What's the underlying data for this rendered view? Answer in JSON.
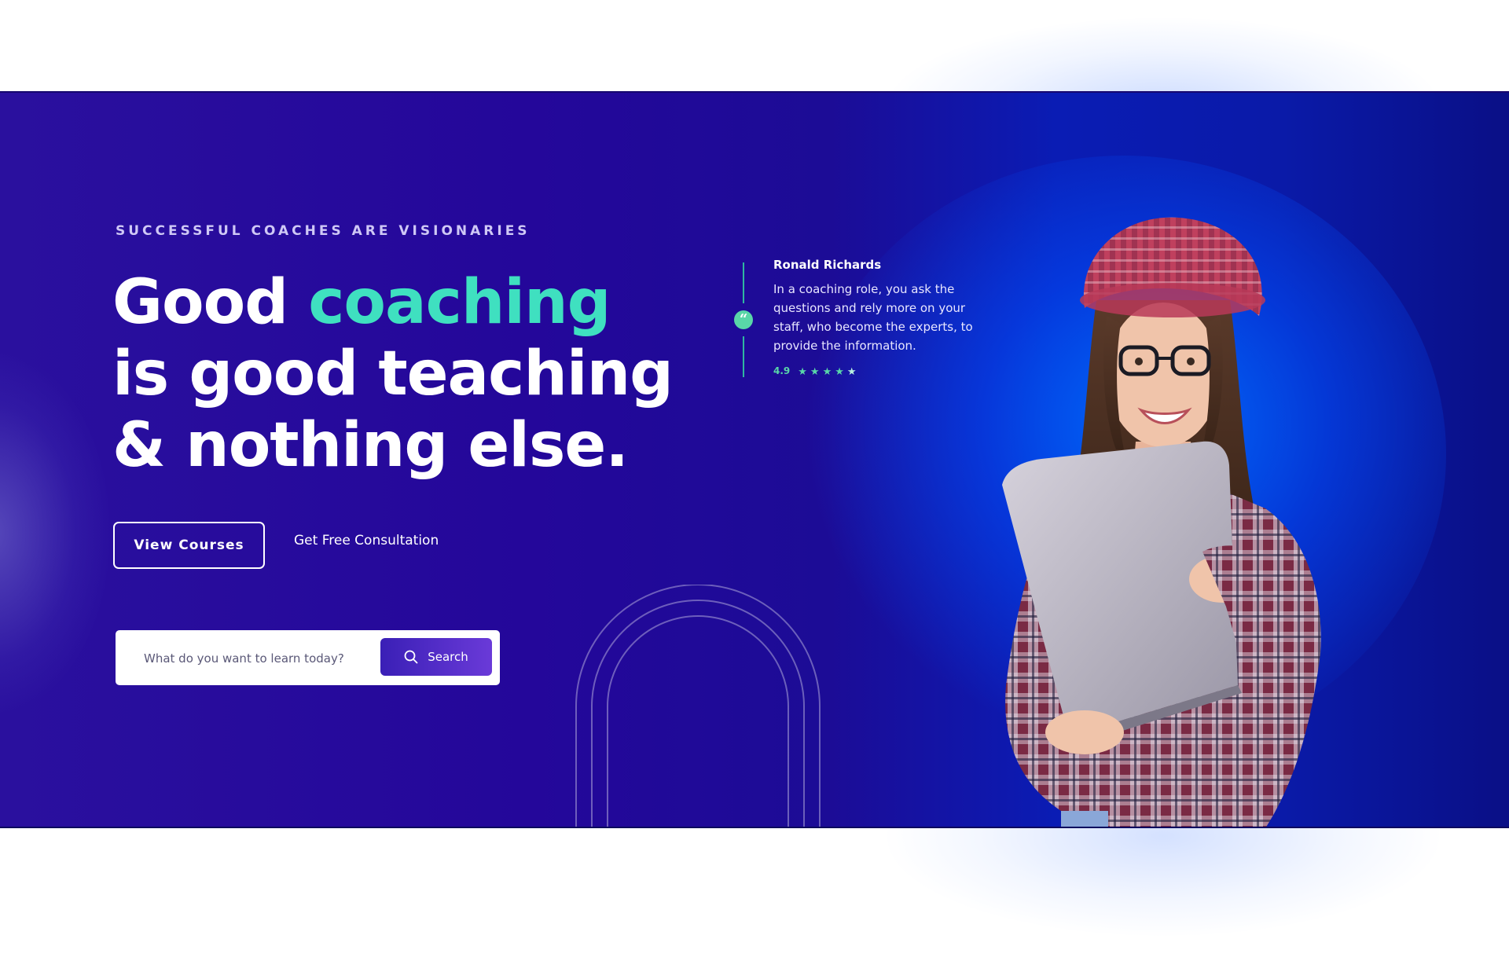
{
  "hero": {
    "eyebrow": "SUCCESSFUL COACHES ARE VISIONARIES",
    "headline": {
      "part1": "Good ",
      "accent": "coaching",
      "part2": " is good teaching & nothing else."
    },
    "primary_button": "View Courses",
    "secondary_link": "Get Free Consultation",
    "search": {
      "placeholder": "What do you want to learn today?",
      "button_label": "Search"
    }
  },
  "testimonial": {
    "quote_mark": "“",
    "name": "Ronald Richards",
    "quote": "In a coaching role, you ask the questions and rely more on your staff, who become the experts, to provide the information.",
    "rating": "4.9",
    "stars": 4.5
  },
  "colors": {
    "accent": "#3fe0c0",
    "hero_bg": "#24079a",
    "rating_green": "#59d6a8"
  },
  "icons": {
    "search": "search-icon",
    "quote": "quote-icon",
    "star": "star-icon"
  }
}
